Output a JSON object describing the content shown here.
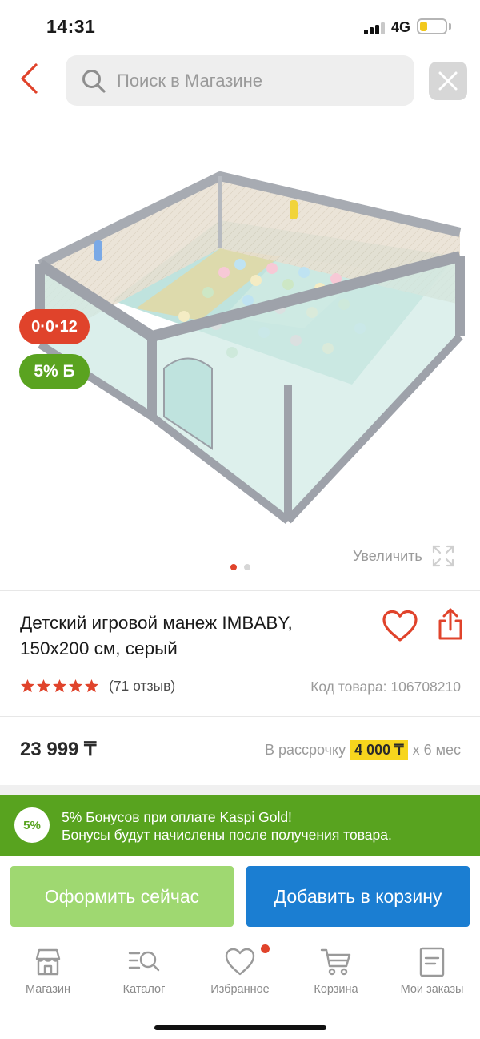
{
  "status_bar": {
    "time": "14:31",
    "network": "4G",
    "battery_level": 0.3,
    "signal_bars": 3
  },
  "header": {
    "back_icon": "chevron-left-icon",
    "search_placeholder": "Поиск в Магазине",
    "search_value": "",
    "close_icon": "close-icon"
  },
  "gallery": {
    "image_name": "baby-playpen-photo",
    "badges": {
      "installment": "0·0·12",
      "bonus": "5% Б"
    },
    "zoom_label": "Увеличить",
    "slide_count": 2,
    "active_slide": 1
  },
  "product": {
    "title": "Детский игровой манеж IMBABY, 150x200 см, серый",
    "rating_stars": 5,
    "reviews": "(71 отзыв)",
    "sku": "Код товара: 106708210",
    "price": "23 999 ₸",
    "installment_prefix": "В рассрочку",
    "installment_amount": "4 000 ₸",
    "installment_suffix": "x 6 мес"
  },
  "bonus_banner": {
    "badge": "5%",
    "line1": "5% Бонусов при оплате Kaspi Gold!",
    "line2": "Бонусы будут начислены после получения товара."
  },
  "actions": {
    "order_now": "Оформить сейчас",
    "add_to_cart": "Добавить в корзину"
  },
  "tabs": [
    {
      "label": "Магазин",
      "icon": "shop-icon"
    },
    {
      "label": "Каталог",
      "icon": "catalog-search-icon"
    },
    {
      "label": "Избранное",
      "icon": "heart-icon",
      "has_notification": true
    },
    {
      "label": "Корзина",
      "icon": "cart-icon"
    },
    {
      "label": "Мои заказы",
      "icon": "orders-icon"
    }
  ],
  "colors": {
    "accent_red": "#e0432b",
    "kaspi_green": "#58a31f",
    "order_button": "#9fd871",
    "cart_button": "#1b7ed2",
    "installment_highlight": "#f7d51d"
  }
}
